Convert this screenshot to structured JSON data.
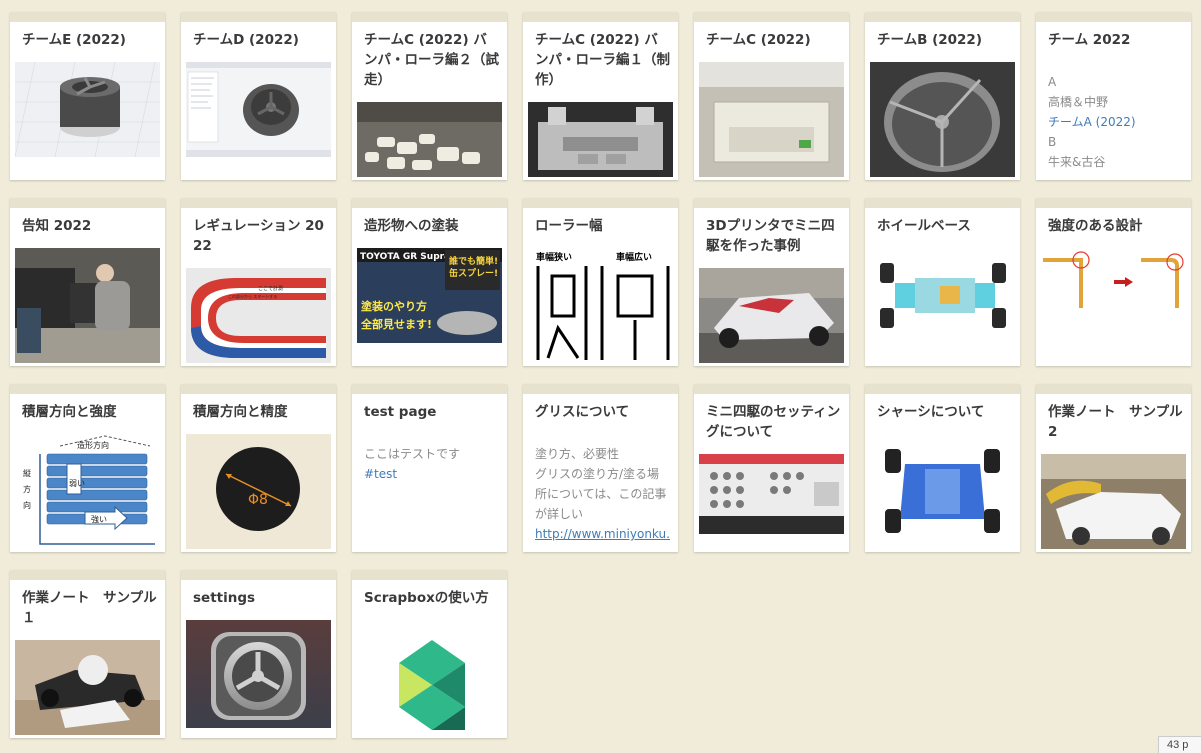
{
  "pages": [
    {
      "title": "チームE (2022)"
    },
    {
      "title": "チームD (2022)"
    },
    {
      "title": "チームC (2022) バンパ・ローラ編２（試走）"
    },
    {
      "title": "チームC (2022) バンパ・ローラ編１（制作）"
    },
    {
      "title": "チームC (2022)"
    },
    {
      "title": "チームB (2022)"
    },
    {
      "title": "チーム 2022",
      "lines": [
        "A",
        "高橋＆中野",
        "チームA (2022)",
        "B",
        "牛来&古谷"
      ]
    },
    {
      "title": "告知 2022"
    },
    {
      "title": "レギュレーション 2022",
      "image_text": [
        "ここで計測",
        "この部分から スタートする"
      ]
    },
    {
      "title": "造形物への塗装",
      "image_text": [
        "TOYOTA GR Supra",
        "誰でも簡単!",
        "缶スプレー!",
        "塗装のやり方",
        "全部見せます!"
      ]
    },
    {
      "title": "ローラー幅",
      "image_text": [
        "車幅狭い",
        "車幅広い"
      ]
    },
    {
      "title": "3Dプリンタでミニ四駆を作った事例"
    },
    {
      "title": "ホイールベース"
    },
    {
      "title": "強度のある設計"
    },
    {
      "title": "積層方向と強度",
      "image_text": [
        "造形方向",
        "縦",
        "方",
        "向",
        "弱い",
        "強い"
      ]
    },
    {
      "title": "積層方向と精度",
      "image_text": [
        "Φ8"
      ]
    },
    {
      "title": "test page",
      "lines": [
        "ここはテストです",
        "#test"
      ]
    },
    {
      "title": "グリスについて",
      "lines": [
        "塗り方、必要性",
        "グリスの塗り方/塗る場所については、この記事が詳しい",
        "http://www.miniyonku.n"
      ]
    },
    {
      "title": "ミニ四駆のセッティングについて"
    },
    {
      "title": "シャーシについて"
    },
    {
      "title": "作業ノート　サンプル2"
    },
    {
      "title": "作業ノート　サンプル１"
    },
    {
      "title": "settings"
    },
    {
      "title": "Scrapboxの使い方"
    }
  ],
  "status_badge": "43 p"
}
